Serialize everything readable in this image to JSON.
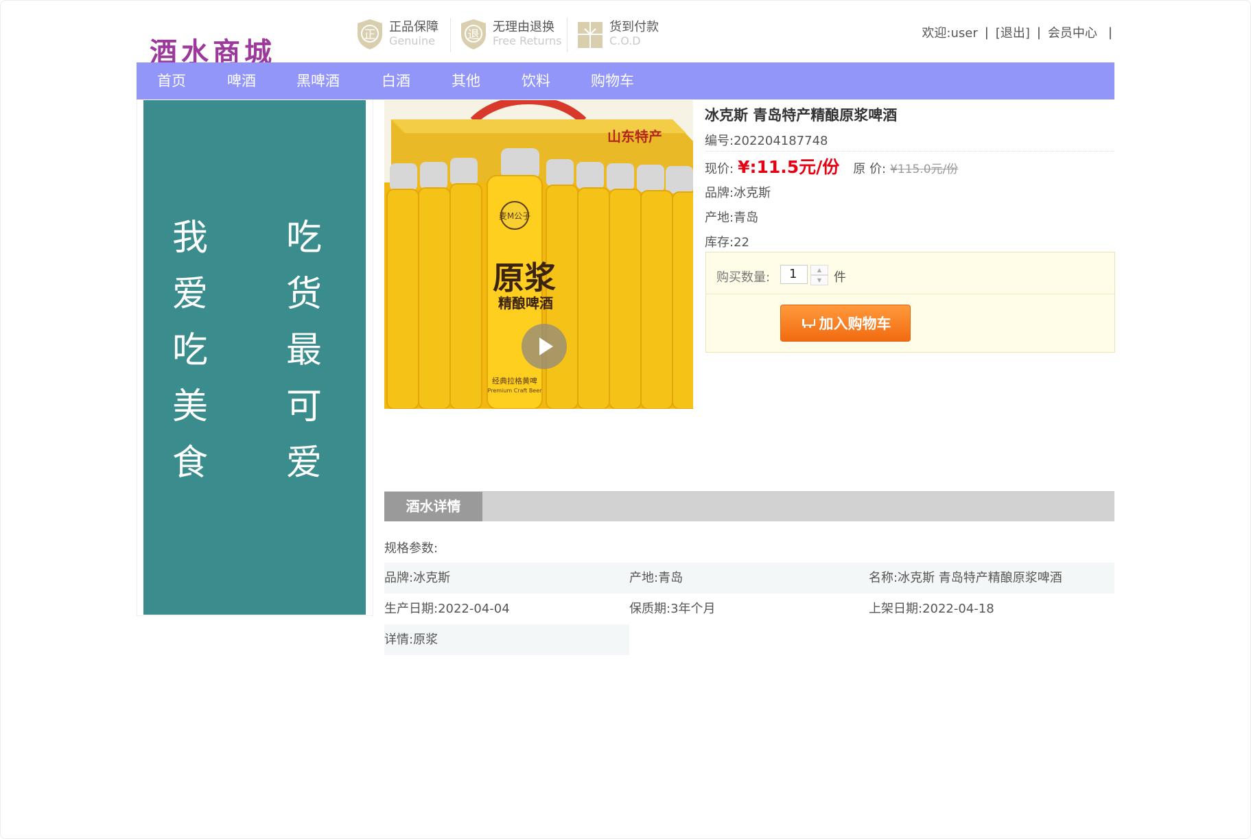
{
  "header": {
    "logo": "酒水商城",
    "guarantees": [
      {
        "zh": "正品保障",
        "en": "Genuine",
        "icon": "正"
      },
      {
        "zh": "无理由退换",
        "en": "Free Returns",
        "icon": "退"
      },
      {
        "zh": "货到付款",
        "en": "C.O.D",
        "icon": "木"
      }
    ],
    "user": {
      "welcome": "欢迎:user",
      "logout": "[退出]",
      "member": "会员中心",
      "sep": "|"
    }
  },
  "nav": [
    "首页",
    "啤酒",
    "黑啤酒",
    "白酒",
    "其他",
    "饮料",
    "购物车"
  ],
  "banner": {
    "col1": [
      "我",
      "爱",
      "吃",
      "美",
      "食"
    ],
    "col2": [
      "吃",
      "货",
      "最",
      "可",
      "爱"
    ]
  },
  "product": {
    "title": "冰克斯 青岛特产精酿原浆啤酒",
    "code": "编号:202204187748",
    "price_label": "现价:",
    "price": "¥:11.5元/份",
    "orig_label": "原 价:",
    "orig_price": "¥115.0元/份",
    "brand": "品牌:冰克斯",
    "origin": "产地:青岛",
    "stock": "库存:22",
    "image_texts": {
      "box": "山东特产",
      "big": "原浆",
      "sub": "精酿啤酒",
      "seal": "麦M公子",
      "small": "经典拉格黄啤",
      "en": "Premium Craft Beer"
    }
  },
  "buy": {
    "qty_label": "购买数量:",
    "qty": "1",
    "unit": "件",
    "add_cart": "加入购物车"
  },
  "details": {
    "tab": "酒水详情",
    "spec_title": "规格参数:",
    "rows": [
      [
        "品牌:冰克斯",
        "产地:青岛",
        "名称:冰克斯 青岛特产精酿原浆啤酒"
      ],
      [
        "生产日期:2022-04-04",
        "保质期:3年个月",
        "上架日期:2022-04-18"
      ],
      [
        "详情:原浆"
      ]
    ]
  },
  "colors": {
    "nav": "#9196f8",
    "banner": "#3a8d8c",
    "price": "#e60012",
    "button": "#f26a10"
  }
}
